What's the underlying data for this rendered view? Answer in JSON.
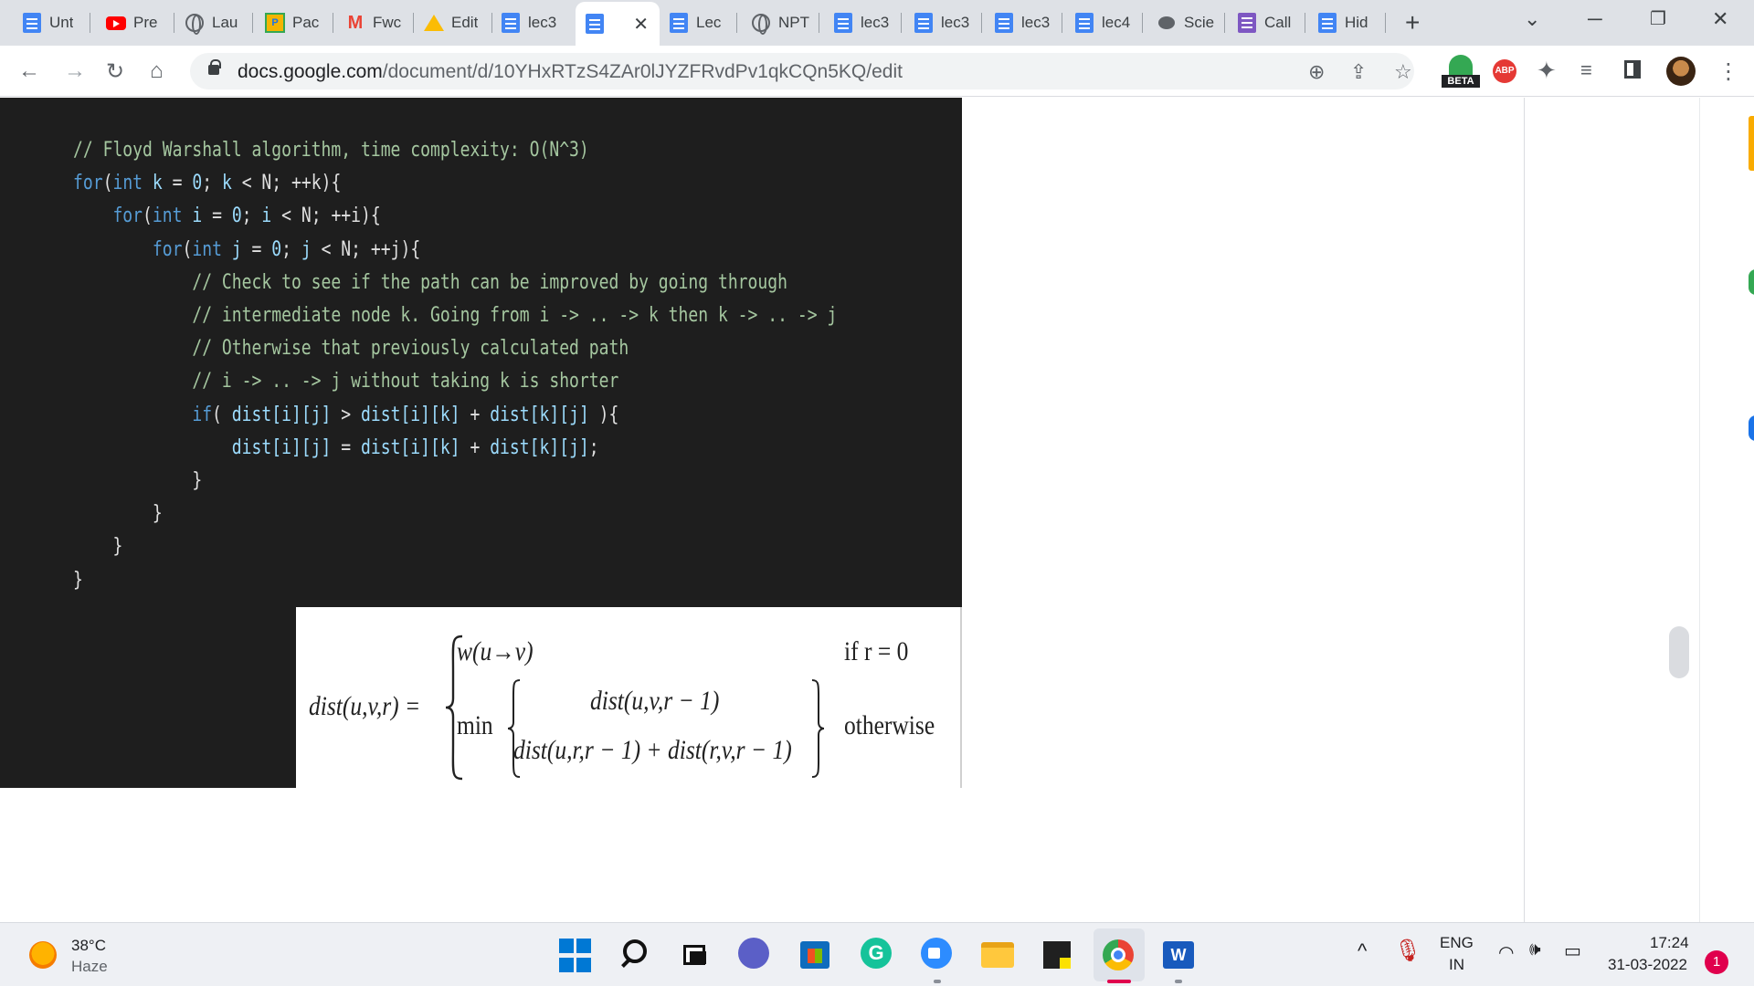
{
  "browser": {
    "tabs": [
      {
        "label": "Unt",
        "icon": "docs-icon"
      },
      {
        "label": "Pre",
        "icon": "youtube-icon"
      },
      {
        "label": "Lau",
        "icon": "globe-icon"
      },
      {
        "label": "Pac",
        "icon": "pac-icon"
      },
      {
        "label": "Fwc",
        "icon": "gmail-icon"
      },
      {
        "label": "Edit",
        "icon": "drive-icon"
      },
      {
        "label": "lec3",
        "icon": "docs-icon"
      },
      {
        "label": "",
        "icon": "docs-icon",
        "active": true
      },
      {
        "label": "Lec",
        "icon": "docs-icon"
      },
      {
        "label": "NPT",
        "icon": "globe-icon"
      },
      {
        "label": "lec3",
        "icon": "docs-icon"
      },
      {
        "label": "lec3",
        "icon": "docs-icon"
      },
      {
        "label": "lec3",
        "icon": "docs-icon"
      },
      {
        "label": "lec4",
        "icon": "docs-icon"
      },
      {
        "label": "Scie",
        "icon": "brain-icon"
      },
      {
        "label": "Call",
        "icon": "list-icon"
      },
      {
        "label": "Hid",
        "icon": "docs-icon"
      }
    ],
    "url_domain": "docs.google.com",
    "url_path": "/document/d/10YHxRTzS4ZAr0lJYZFRvdPv1qkCQn5KQ/edit",
    "extension_beta_label": "BETA",
    "extension_abp_label": "ABP"
  },
  "document": {
    "code_lines": [
      [
        {
          "t": "// Floyd Warshall algorithm, time complexity: O(N^3)",
          "c": "comment"
        }
      ],
      [
        {
          "t": "for",
          "c": "kw"
        },
        {
          "t": "(",
          "c": "plain"
        },
        {
          "t": "int",
          "c": "kw"
        },
        {
          "t": " k ",
          "c": "id"
        },
        {
          "t": "= ",
          "c": "plain"
        },
        {
          "t": "0",
          "c": "id"
        },
        {
          "t": "; ",
          "c": "plain"
        },
        {
          "t": "k ",
          "c": "id"
        },
        {
          "t": "< N; ++k){",
          "c": "plain"
        }
      ],
      [
        {
          "t": "    for",
          "c": "kw"
        },
        {
          "t": "(",
          "c": "plain"
        },
        {
          "t": "int",
          "c": "kw"
        },
        {
          "t": " i ",
          "c": "id"
        },
        {
          "t": "= ",
          "c": "plain"
        },
        {
          "t": "0",
          "c": "id"
        },
        {
          "t": "; ",
          "c": "plain"
        },
        {
          "t": "i ",
          "c": "id"
        },
        {
          "t": "< N; ++i){",
          "c": "plain"
        }
      ],
      [
        {
          "t": "        for",
          "c": "kw"
        },
        {
          "t": "(",
          "c": "plain"
        },
        {
          "t": "int",
          "c": "kw"
        },
        {
          "t": " j ",
          "c": "id"
        },
        {
          "t": "= ",
          "c": "plain"
        },
        {
          "t": "0",
          "c": "id"
        },
        {
          "t": "; ",
          "c": "plain"
        },
        {
          "t": "j ",
          "c": "id"
        },
        {
          "t": "< N; ++j){",
          "c": "plain"
        }
      ],
      [
        {
          "t": "            // Check to see if the path can be improved by going through",
          "c": "comment"
        }
      ],
      [
        {
          "t": "            // intermediate node k. Going from i -> .. -> k then k -> .. -> j",
          "c": "comment"
        }
      ],
      [
        {
          "t": "            // Otherwise that previously calculated path",
          "c": "comment"
        }
      ],
      [
        {
          "t": "            // i -> .. -> j without taking k is shorter",
          "c": "comment"
        }
      ],
      [
        {
          "t": "            if",
          "c": "kw"
        },
        {
          "t": "( ",
          "c": "plain"
        },
        {
          "t": "dist[i][j]",
          "c": "id"
        },
        {
          "t": " > ",
          "c": "plain"
        },
        {
          "t": "dist[i][k]",
          "c": "id"
        },
        {
          "t": " + ",
          "c": "plain"
        },
        {
          "t": "dist[k][j]",
          "c": "id"
        },
        {
          "t": " ){",
          "c": "plain"
        }
      ],
      [
        {
          "t": "                dist[i][j]",
          "c": "id"
        },
        {
          "t": " = ",
          "c": "plain"
        },
        {
          "t": "dist[i][k]",
          "c": "id"
        },
        {
          "t": " + ",
          "c": "plain"
        },
        {
          "t": "dist[k][j]",
          "c": "id"
        },
        {
          "t": ";",
          "c": "plain"
        }
      ],
      [
        {
          "t": "            }",
          "c": "plain"
        }
      ],
      [
        {
          "t": "        }",
          "c": "plain"
        }
      ],
      [
        {
          "t": "    }",
          "c": "plain"
        }
      ],
      [
        {
          "t": "}",
          "c": "plain"
        }
      ]
    ],
    "formula": {
      "lhs": "dist(u,v,r) =",
      "case1_expr": "w(u→v)",
      "case1_cond": "if r = 0",
      "case2_min": "min",
      "case2_top": "dist(u,v,r − 1)",
      "case2_bottom": "dist(u,r,r − 1) + dist(r,v,r − 1)",
      "case2_cond": "otherwise"
    }
  },
  "taskbar": {
    "weather_temp": "38°C",
    "weather_desc": "Haze",
    "lang_top": "ENG",
    "lang_bottom": "IN",
    "time": "17:24",
    "date": "31-03-2022",
    "notification_count": "1",
    "grammarly_letter": "G",
    "word_letter": "W"
  }
}
